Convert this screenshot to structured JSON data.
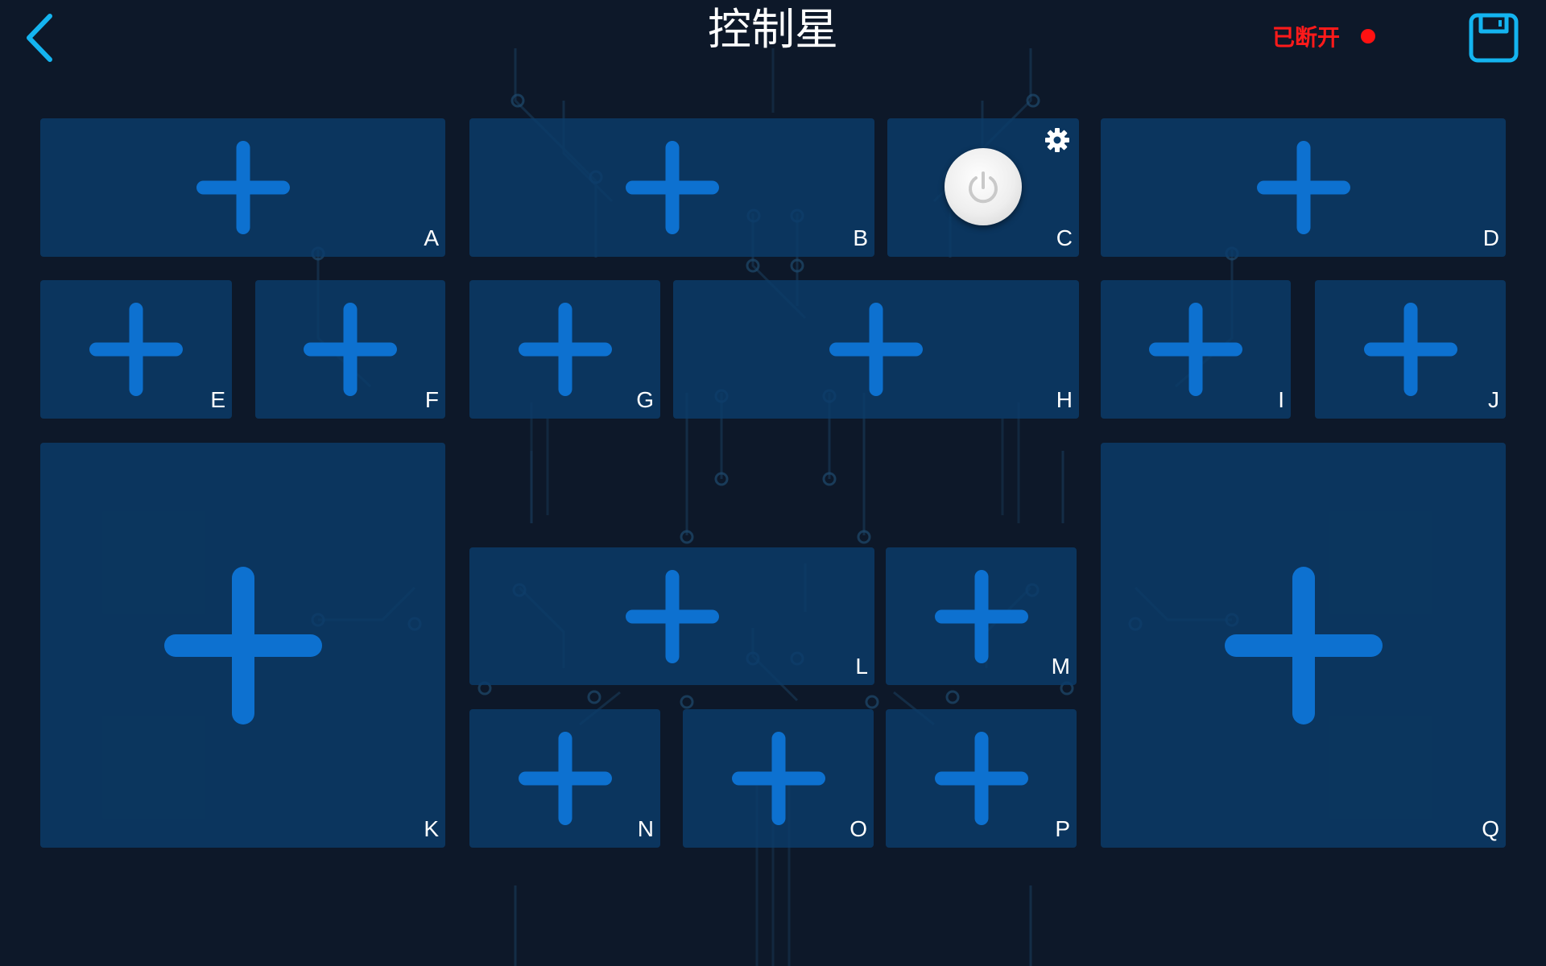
{
  "header": {
    "title": "控制星",
    "status_text": "已断开",
    "back_icon": "chevron-left-icon",
    "save_icon": "save-icon",
    "status_color": "#ff1a1a",
    "accent_color": "#14b4f0"
  },
  "tiles": {
    "A": {
      "label": "A"
    },
    "B": {
      "label": "B"
    },
    "C": {
      "label": "C",
      "icons": [
        "power-icon",
        "gear-icon"
      ]
    },
    "D": {
      "label": "D"
    },
    "E": {
      "label": "E"
    },
    "F": {
      "label": "F"
    },
    "G": {
      "label": "G"
    },
    "H": {
      "label": "H"
    },
    "I": {
      "label": "I"
    },
    "J": {
      "label": "J"
    },
    "K": {
      "label": "K"
    },
    "L": {
      "label": "L"
    },
    "M": {
      "label": "M"
    },
    "N": {
      "label": "N"
    },
    "O": {
      "label": "O"
    },
    "P": {
      "label": "P"
    },
    "Q": {
      "label": "Q"
    }
  },
  "colors": {
    "background": "#0d1829",
    "tile": "#0b3c6a",
    "plus": "#0d71d0"
  }
}
